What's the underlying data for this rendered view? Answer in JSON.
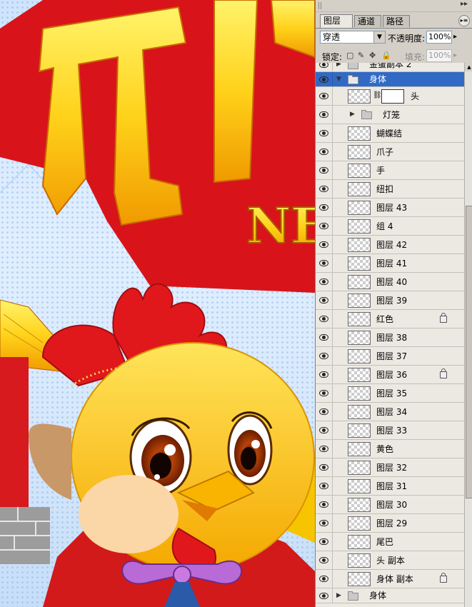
{
  "artwork": {
    "big_char": "开",
    "small_text": "NE"
  },
  "panel": {
    "tabs": [
      {
        "label": "图层",
        "close": "×"
      },
      {
        "label": "通道"
      },
      {
        "label": "路径"
      }
    ],
    "blend_mode": "穿透",
    "opacity_label": "不透明度:",
    "opacity_value": "100%",
    "lock_label": "锁定:",
    "fill_label": "填充:",
    "fill_value": "100%"
  },
  "layers": [
    {
      "name": "金蛋副本 2",
      "type": "group",
      "level": 0,
      "expanded": false,
      "partial": true
    },
    {
      "name": "身体",
      "type": "group",
      "level": 0,
      "expanded": true,
      "selected": true
    },
    {
      "name": "头",
      "type": "mask-layer",
      "level": 1
    },
    {
      "name": "灯笼",
      "type": "group",
      "level": 1,
      "expanded": false
    },
    {
      "name": "蝴蝶结",
      "type": "layer",
      "level": 1
    },
    {
      "name": "爪子",
      "type": "layer",
      "level": 1
    },
    {
      "name": "手",
      "type": "layer",
      "level": 1
    },
    {
      "name": "纽扣",
      "type": "layer",
      "level": 1
    },
    {
      "name": "图层 43",
      "type": "layer",
      "level": 1
    },
    {
      "name": "组 4",
      "type": "layer",
      "level": 1
    },
    {
      "name": "图层 42",
      "type": "layer",
      "level": 1
    },
    {
      "name": "图层 41",
      "type": "layer",
      "level": 1
    },
    {
      "name": "图层 40",
      "type": "layer",
      "level": 1
    },
    {
      "name": "图层 39",
      "type": "layer",
      "level": 1
    },
    {
      "name": "红色",
      "type": "layer",
      "level": 1,
      "locked": true
    },
    {
      "name": "图层 38",
      "type": "layer",
      "level": 1
    },
    {
      "name": "图层 37",
      "type": "layer",
      "level": 1
    },
    {
      "name": "图层 36",
      "type": "layer",
      "level": 1,
      "locked": true
    },
    {
      "name": "图层 35",
      "type": "layer",
      "level": 1
    },
    {
      "name": "图层 34",
      "type": "layer",
      "level": 1
    },
    {
      "name": "图层 33",
      "type": "layer",
      "level": 1
    },
    {
      "name": "黄色",
      "type": "layer",
      "level": 1
    },
    {
      "name": "图层 32",
      "type": "layer",
      "level": 1
    },
    {
      "name": "图层 31",
      "type": "layer",
      "level": 1
    },
    {
      "name": "图层 30",
      "type": "layer",
      "level": 1
    },
    {
      "name": "图层 29",
      "type": "layer",
      "level": 1
    },
    {
      "name": "尾巴",
      "type": "layer",
      "level": 1
    },
    {
      "name": "头 副本",
      "type": "layer",
      "level": 1
    },
    {
      "name": "身体 副本",
      "type": "layer",
      "level": 1,
      "locked": true
    },
    {
      "name": "身体",
      "type": "group",
      "level": 0,
      "expanded": false
    }
  ],
  "colors": {
    "selection": "#316ac5",
    "panel_bg": "#d4d0c8",
    "list_bg": "#ece9e3"
  }
}
